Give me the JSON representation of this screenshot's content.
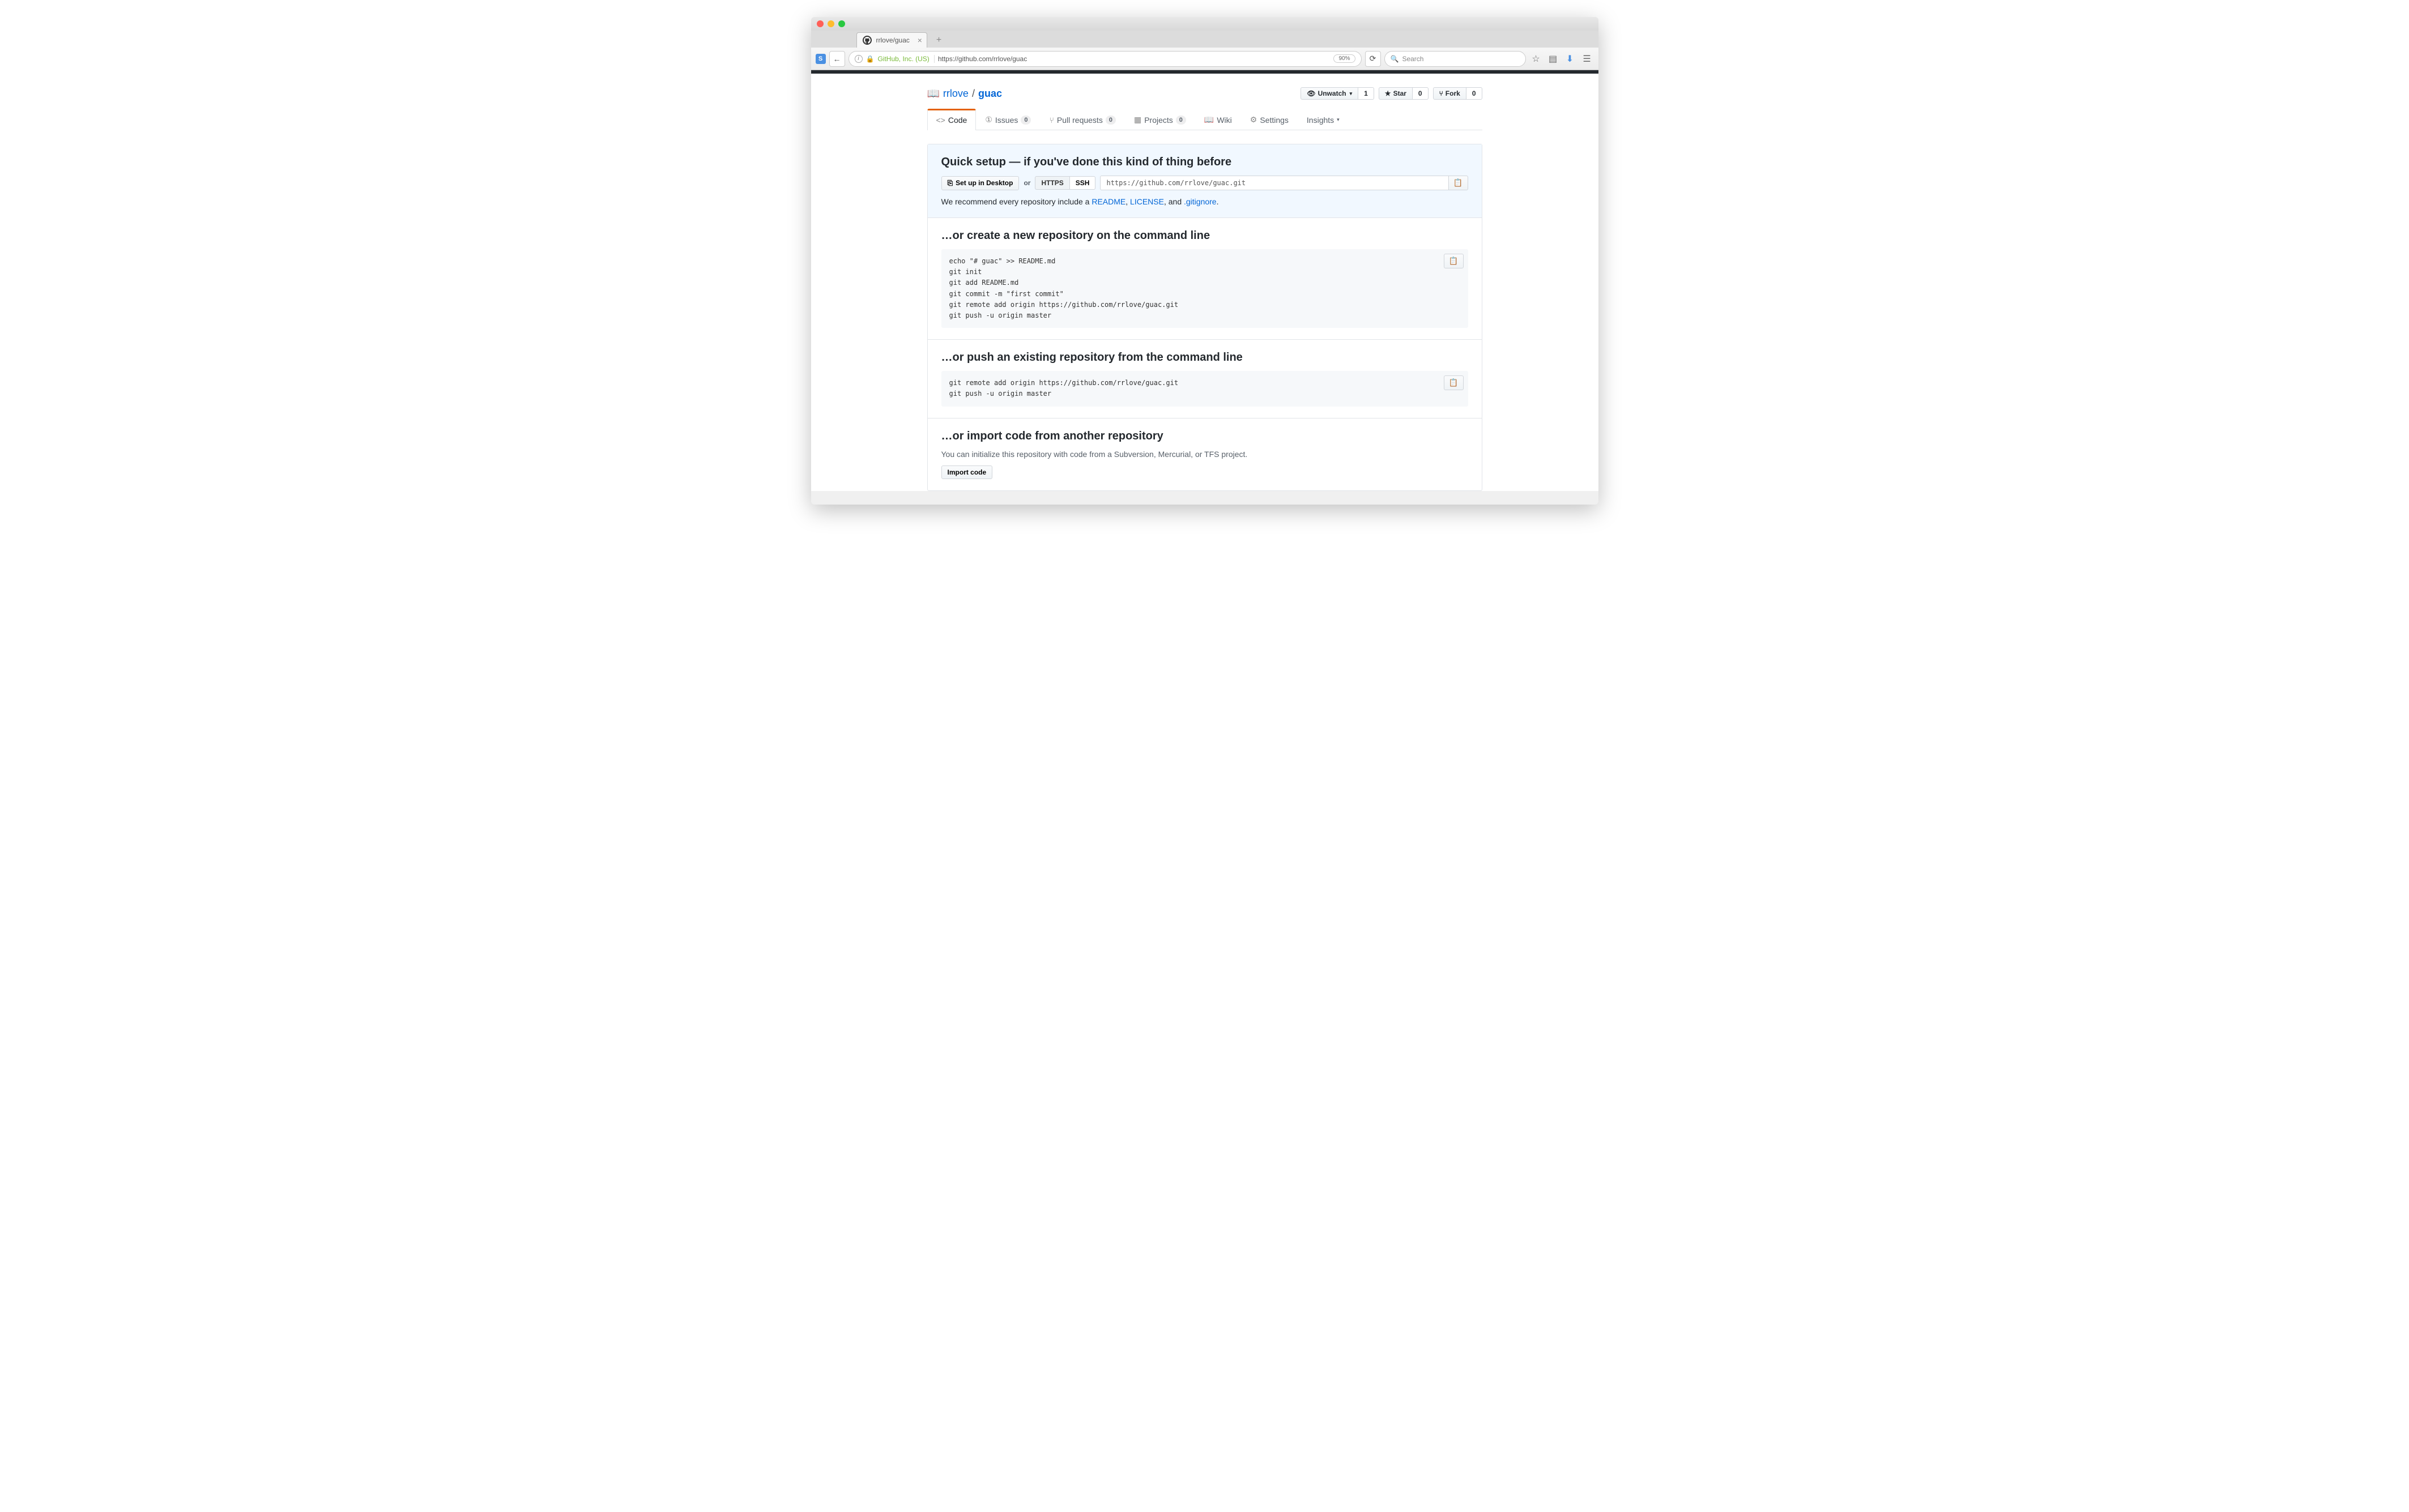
{
  "browser": {
    "tab_title": "rrlove/guac",
    "url_identity": "GitHub, Inc. (US)",
    "url": "https://github.com/rrlove/guac",
    "zoom": "90%",
    "search_placeholder": "Search"
  },
  "repo": {
    "owner": "rrlove",
    "name": "guac",
    "actions": {
      "unwatch_label": "Unwatch",
      "watch_count": "1",
      "star_label": "Star",
      "star_count": "0",
      "fork_label": "Fork",
      "fork_count": "0"
    }
  },
  "nav": {
    "code": "Code",
    "issues": "Issues",
    "issues_count": "0",
    "pulls": "Pull requests",
    "pulls_count": "0",
    "projects": "Projects",
    "projects_count": "0",
    "wiki": "Wiki",
    "settings": "Settings",
    "insights": "Insights"
  },
  "quick": {
    "heading": "Quick setup — if you've done this kind of thing before",
    "desktop_btn": "Set up in Desktop",
    "or": "or",
    "https": "HTTPS",
    "ssh": "SSH",
    "clone_url": "https://github.com/rrlove/guac.git",
    "recommend_pre": "We recommend every repository include a ",
    "readme": "README",
    "comma1": ", ",
    "license": "LICENSE",
    "and": ", and ",
    "gitignore": ".gitignore",
    "period": "."
  },
  "create": {
    "heading": "…or create a new repository on the command line",
    "code": "echo \"# guac\" >> README.md\ngit init\ngit add README.md\ngit commit -m \"first commit\"\ngit remote add origin https://github.com/rrlove/guac.git\ngit push -u origin master"
  },
  "push": {
    "heading": "…or push an existing repository from the command line",
    "code": "git remote add origin https://github.com/rrlove/guac.git\ngit push -u origin master"
  },
  "import": {
    "heading": "…or import code from another repository",
    "help": "You can initialize this repository with code from a Subversion, Mercurial, or TFS project.",
    "btn": "Import code"
  }
}
